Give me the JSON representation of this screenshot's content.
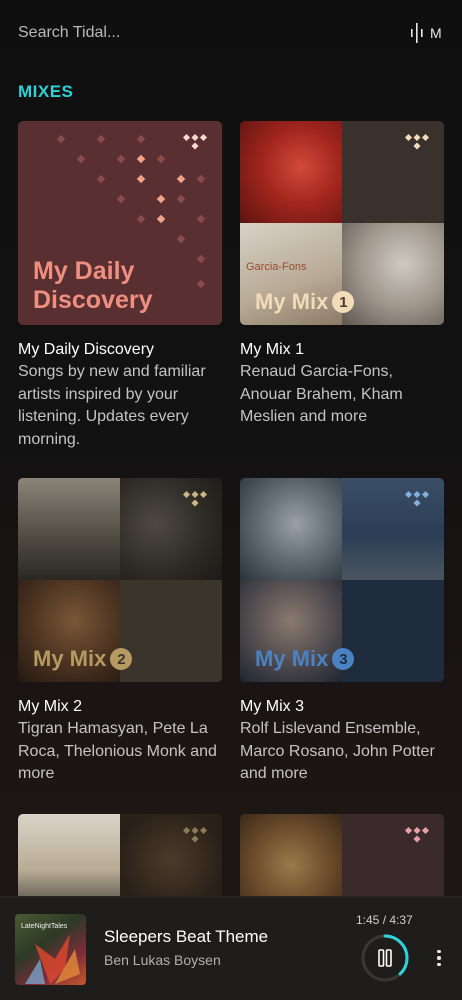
{
  "search": {
    "placeholder": "Search Tidal..."
  },
  "header": {
    "profile_initial": "M"
  },
  "section": {
    "title": "MIXES"
  },
  "mixes": [
    {
      "art_label": "My Daily\nDiscovery",
      "title": "My Daily Discovery",
      "description": "Songs by new and familiar artists inspired by your listening. Updates every morning."
    },
    {
      "art_label": "My Mix",
      "badge": "1",
      "title": "My Mix 1",
      "description": "Renaud Garcia-Fons, Anouar Brahem, Kham Meslien and more",
      "cover_text": "Garcia-Fons"
    },
    {
      "art_label": "My Mix",
      "badge": "2",
      "title": "My Mix 2",
      "description": "Tigran Hamasyan, Pete La Roca, Thelonious Monk and more"
    },
    {
      "art_label": "My Mix",
      "badge": "3",
      "title": "My Mix 3",
      "description": "Rolf Lislevand Ensemble, Marco Rosano, John Potter and more"
    },
    {
      "title": "",
      "description": ""
    },
    {
      "title": "",
      "description": ""
    }
  ],
  "player": {
    "track_title": "Sleepers Beat Theme",
    "artist": "Ben Lukas Boysen",
    "time": "1:45 / 4:37",
    "progress": 0.379,
    "cover_text": "LateNightTales"
  },
  "colors": {
    "accent": "#2fd3d6",
    "daily_text": "#ee8f7f",
    "mix1": "#f2dbb8",
    "mix2": "#b59a63",
    "mix3": "#4b82c3"
  }
}
